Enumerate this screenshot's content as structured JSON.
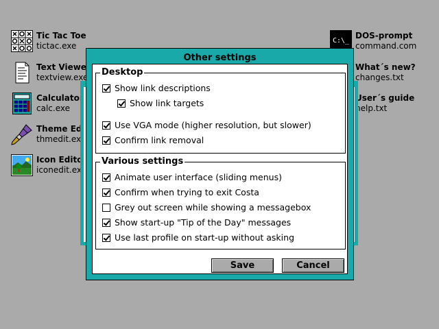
{
  "desktop_left": [
    {
      "title": "Tic Tac Toe",
      "file": "tictac.exe",
      "icon": "tictactoe-icon"
    },
    {
      "title": "Text Viewer",
      "file": "textview.exe",
      "icon": "text-document-icon"
    },
    {
      "title": "Calculator",
      "file": "calc.exe",
      "icon": "calculator-icon"
    },
    {
      "title": "Theme Editor",
      "file": "thmedit.exe",
      "icon": "paintbrush-icon"
    },
    {
      "title": "Icon Editor",
      "file": "iconedit.exe",
      "icon": "landscape-image-icon"
    }
  ],
  "desktop_right": [
    {
      "title": "DOS-prompt",
      "file": "command.com",
      "icon": "dos-prompt-icon",
      "icon_text": "C:\\_"
    },
    {
      "title": "What´s new?",
      "file": "changes.txt"
    },
    {
      "title": "User´s guide",
      "file": "help.txt"
    }
  ],
  "dialog": {
    "title": "Other settings",
    "groups": [
      {
        "label": "Desktop",
        "items": [
          {
            "label": "Show link descriptions",
            "checked": true
          },
          {
            "label": "Show link targets",
            "checked": true
          },
          {
            "label": "Use VGA mode (higher resolution, but slower)",
            "checked": true
          },
          {
            "label": "Confirm link removal",
            "checked": true
          }
        ]
      },
      {
        "label": "Various settings",
        "items": [
          {
            "label": "Animate user interface (sliding menus)",
            "checked": true
          },
          {
            "label": "Confirm when trying to exit Costa",
            "checked": true
          },
          {
            "label": "Grey out screen while showing a messagebox",
            "checked": false
          },
          {
            "label": "Show start-up \"Tip of the Day\" messages",
            "checked": true
          },
          {
            "label": "Use last profile on start-up without asking",
            "checked": true
          }
        ]
      }
    ],
    "buttons": {
      "save": "Save",
      "cancel": "Cancel"
    }
  },
  "colors": {
    "desktop": "#aaaaaa",
    "window_frame": "#1aa9a9",
    "button": "#aaaaaa"
  }
}
